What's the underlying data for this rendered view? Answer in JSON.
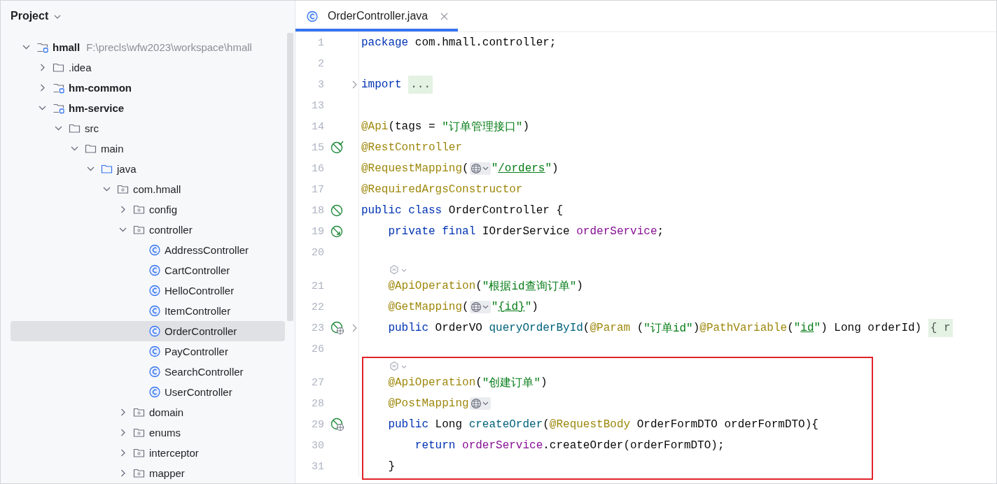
{
  "project_panel": {
    "title": "Project",
    "tree": [
      {
        "label": "hmall",
        "kind": "module",
        "path": "F:\\precls\\wfw2023\\workspace\\hmall",
        "expanded": true,
        "selected": false,
        "children": [
          {
            "label": ".idea",
            "kind": "folder",
            "expanded": false,
            "selected": false
          },
          {
            "label": "hm-common",
            "kind": "module",
            "expanded": false,
            "selected": false
          },
          {
            "label": "hm-service",
            "kind": "module",
            "expanded": true,
            "selected": false,
            "children": [
              {
                "label": "src",
                "kind": "folder",
                "expanded": true,
                "selected": false,
                "children": [
                  {
                    "label": "main",
                    "kind": "folder",
                    "expanded": true,
                    "selected": false,
                    "children": [
                      {
                        "label": "java",
                        "kind": "source-root",
                        "expanded": true,
                        "selected": false,
                        "children": [
                          {
                            "label": "com.hmall",
                            "kind": "package",
                            "expanded": true,
                            "selected": false,
                            "children": [
                              {
                                "label": "config",
                                "kind": "package",
                                "expanded": false,
                                "selected": false
                              },
                              {
                                "label": "controller",
                                "kind": "package",
                                "expanded": true,
                                "selected": false,
                                "children": [
                                  {
                                    "label": "AddressController",
                                    "kind": "class",
                                    "selected": false
                                  },
                                  {
                                    "label": "CartController",
                                    "kind": "class",
                                    "selected": false
                                  },
                                  {
                                    "label": "HelloController",
                                    "kind": "class",
                                    "selected": false
                                  },
                                  {
                                    "label": "ItemController",
                                    "kind": "class",
                                    "selected": false
                                  },
                                  {
                                    "label": "OrderController",
                                    "kind": "class",
                                    "selected": true
                                  },
                                  {
                                    "label": "PayController",
                                    "kind": "class",
                                    "selected": false
                                  },
                                  {
                                    "label": "SearchController",
                                    "kind": "class",
                                    "selected": false
                                  },
                                  {
                                    "label": "UserController",
                                    "kind": "class",
                                    "selected": false
                                  }
                                ]
                              },
                              {
                                "label": "domain",
                                "kind": "package",
                                "expanded": false,
                                "selected": false
                              },
                              {
                                "label": "enums",
                                "kind": "package",
                                "expanded": false,
                                "selected": false
                              },
                              {
                                "label": "interceptor",
                                "kind": "package",
                                "expanded": false,
                                "selected": false
                              },
                              {
                                "label": "mapper",
                                "kind": "package",
                                "expanded": false,
                                "selected": false
                              }
                            ]
                          }
                        ]
                      }
                    ]
                  }
                ]
              }
            ]
          }
        ]
      }
    ]
  },
  "editor": {
    "tabs": [
      {
        "label": "OrderController.java",
        "selected": true
      }
    ],
    "lines": [
      {
        "kind": "code",
        "number": "1",
        "tokens": [
          {
            "kind": "keyword",
            "text": "package"
          },
          {
            "kind": "plain",
            "text": " com.hmall.controller;"
          }
        ]
      },
      {
        "kind": "code",
        "number": "2"
      },
      {
        "kind": "code",
        "number": "3",
        "foldable": true,
        "tokens": [
          {
            "kind": "keyword",
            "text": "import "
          },
          {
            "kind": "fold",
            "text": "..."
          }
        ]
      },
      {
        "kind": "code",
        "number": "13"
      },
      {
        "kind": "code",
        "number": "14",
        "tokens": [
          {
            "kind": "annotation",
            "text": "@Api"
          },
          {
            "kind": "plain",
            "text": "(tags = "
          },
          {
            "kind": "string",
            "text": "\"订单管理接口\""
          },
          {
            "kind": "plain",
            "text": ")"
          }
        ]
      },
      {
        "kind": "code",
        "number": "15",
        "gutter": {
          "kind": "bean-check"
        },
        "tokens": [
          {
            "kind": "annotation",
            "text": "@RestController"
          }
        ]
      },
      {
        "kind": "code",
        "number": "16",
        "tokens": [
          {
            "kind": "annotation",
            "text": "@RequestMapping"
          },
          {
            "kind": "plain",
            "text": "("
          },
          {
            "kind": "globe"
          },
          {
            "kind": "string",
            "text": "\""
          },
          {
            "kind": "string",
            "text": "/orders",
            "underlined": true
          },
          {
            "kind": "string",
            "text": "\""
          },
          {
            "kind": "plain",
            "text": ")"
          }
        ]
      },
      {
        "kind": "code",
        "number": "17",
        "tokens": [
          {
            "kind": "annotation",
            "text": "@RequiredArgsConstructor"
          }
        ]
      },
      {
        "kind": "code",
        "number": "18",
        "gutter": {
          "kind": "bean"
        },
        "tokens": [
          {
            "kind": "keyword",
            "text": "public class"
          },
          {
            "kind": "plain",
            "text": " OrderController {"
          }
        ]
      },
      {
        "kind": "code",
        "number": "19",
        "gutter": {
          "kind": "bean-ref"
        },
        "tokens": [
          {
            "kind": "keyword",
            "text": "    private final"
          },
          {
            "kind": "plain",
            "text": " IOrderService "
          },
          {
            "kind": "field",
            "text": "orderService"
          },
          {
            "kind": "plain",
            "text": ";"
          }
        ]
      },
      {
        "kind": "code",
        "number": "20"
      },
      {
        "kind": "hint"
      },
      {
        "kind": "code",
        "number": "21",
        "tokens": [
          {
            "kind": "annotation",
            "text": "    @ApiOperation"
          },
          {
            "kind": "plain",
            "text": "("
          },
          {
            "kind": "string",
            "text": "\"根据id查询订单\""
          },
          {
            "kind": "plain",
            "text": ")"
          }
        ]
      },
      {
        "kind": "code",
        "number": "22",
        "tokens": [
          {
            "kind": "annotation",
            "text": "    @GetMapping"
          },
          {
            "kind": "plain",
            "text": "("
          },
          {
            "kind": "globe"
          },
          {
            "kind": "string",
            "text": "\""
          },
          {
            "kind": "string",
            "text": "{id}",
            "underlined": true
          },
          {
            "kind": "string",
            "text": "\""
          },
          {
            "kind": "plain",
            "text": ")"
          }
        ]
      },
      {
        "kind": "code",
        "number": "23",
        "gutter": {
          "kind": "endpoint"
        },
        "foldable": true,
        "tokens": [
          {
            "kind": "keyword",
            "text": "    public"
          },
          {
            "kind": "plain",
            "text": " OrderVO "
          },
          {
            "kind": "method",
            "text": "queryOrderById"
          },
          {
            "kind": "plain",
            "text": "("
          },
          {
            "kind": "annotation",
            "text": "@Param"
          },
          {
            "kind": "plain",
            "text": " ("
          },
          {
            "kind": "string",
            "text": "\"订单id\""
          },
          {
            "kind": "plain",
            "text": ")"
          },
          {
            "kind": "annotation",
            "text": "@PathVariable"
          },
          {
            "kind": "plain",
            "text": "("
          },
          {
            "kind": "string",
            "text": "\""
          },
          {
            "kind": "string",
            "text": "id",
            "underlined": true
          },
          {
            "kind": "string",
            "text": "\""
          },
          {
            "kind": "plain",
            "text": ") Long orderId) "
          },
          {
            "kind": "fold",
            "text": "{ r"
          }
        ]
      },
      {
        "kind": "code",
        "number": "26"
      },
      {
        "kind": "hint",
        "highlighted": true
      },
      {
        "kind": "code",
        "number": "27",
        "highlighted": true,
        "tokens": [
          {
            "kind": "annotation",
            "text": "    @ApiOperation"
          },
          {
            "kind": "plain",
            "text": "("
          },
          {
            "kind": "string",
            "text": "\"创建订单\""
          },
          {
            "kind": "plain",
            "text": ")"
          }
        ]
      },
      {
        "kind": "code",
        "number": "28",
        "highlighted": true,
        "tokens": [
          {
            "kind": "annotation",
            "text": "    @PostMapping"
          },
          {
            "kind": "globe"
          }
        ]
      },
      {
        "kind": "code",
        "number": "29",
        "gutter": {
          "kind": "endpoint"
        },
        "highlighted": true,
        "tokens": [
          {
            "kind": "keyword",
            "text": "    public"
          },
          {
            "kind": "plain",
            "text": " Long "
          },
          {
            "kind": "method",
            "text": "createOrder"
          },
          {
            "kind": "plain",
            "text": "("
          },
          {
            "kind": "annotation",
            "text": "@RequestBody"
          },
          {
            "kind": "plain",
            "text": " OrderFormDTO orderFormDTO){"
          }
        ]
      },
      {
        "kind": "code",
        "number": "30",
        "highlighted": true,
        "tokens": [
          {
            "kind": "keyword",
            "text": "        return "
          },
          {
            "kind": "field",
            "text": "orderService"
          },
          {
            "kind": "plain",
            "text": ".createOrder(orderFormDTO);"
          }
        ]
      },
      {
        "kind": "code",
        "number": "31",
        "highlighted": true,
        "tokens": [
          {
            "kind": "plain",
            "text": "    }"
          }
        ]
      }
    ]
  }
}
